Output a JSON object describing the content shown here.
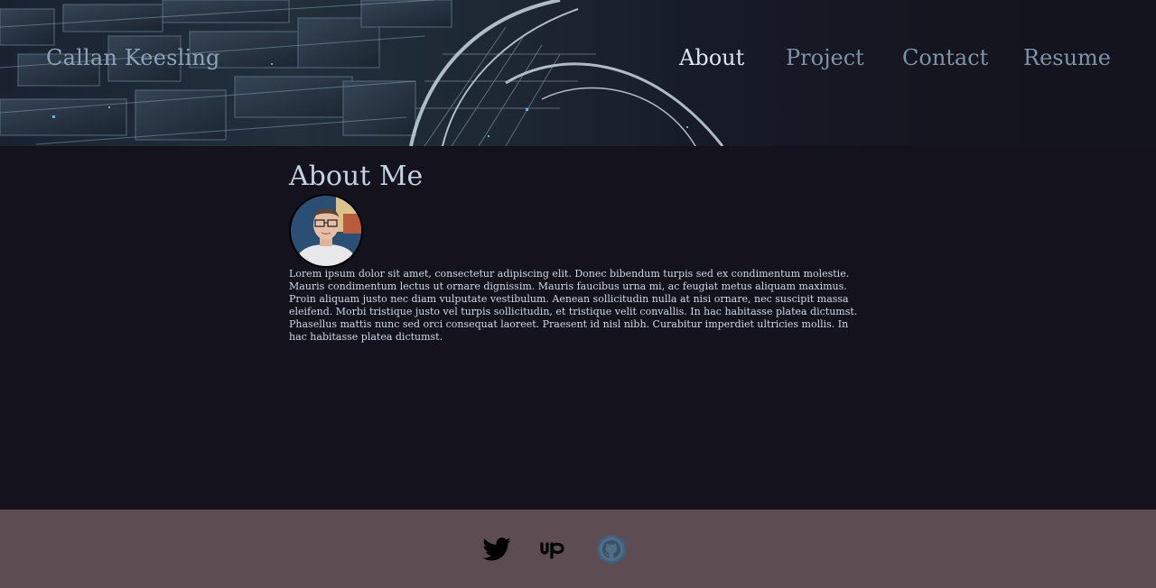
{
  "site": {
    "brand": "Callan Keesling"
  },
  "nav": {
    "items": [
      {
        "label": "About",
        "active": true
      },
      {
        "label": "Project",
        "active": false
      },
      {
        "label": "Contact",
        "active": false
      },
      {
        "label": "Resume",
        "active": false
      }
    ]
  },
  "about": {
    "title": "About Me",
    "bio": "Lorem ipsum dolor sit amet, consectetur adipiscing elit. Donec bibendum turpis sed ex condimentum molestie. Mauris condimentum lectus ut ornare dignissim. Mauris faucibus urna mi, ac feugiat metus aliquam maximus. Proin aliquam justo nec diam vulputate vestibulum. Aenean sollicitudin nulla at nisi ornare, nec suscipit massa eleifend. Morbi tristique justo vel turpis sollicitudin, et tristique velit convallis. In hac habitasse platea dictumst. Phasellus mattis nunc sed orci consequat laoreet. Praesent id nisl nibh. Curabitur imperdiet ultricies mollis. In hac habitasse platea dictumst."
  },
  "footer": {
    "social": [
      {
        "icon": "twitter-icon"
      },
      {
        "icon": "upwork-icon"
      },
      {
        "icon": "github-icon"
      }
    ]
  },
  "colors": {
    "page_background": "#13121d",
    "footer_background": "#5d4d52",
    "nav_active": "#dde6ef",
    "nav_inactive": "#7d93a8",
    "heading": "#c2d2e3"
  }
}
